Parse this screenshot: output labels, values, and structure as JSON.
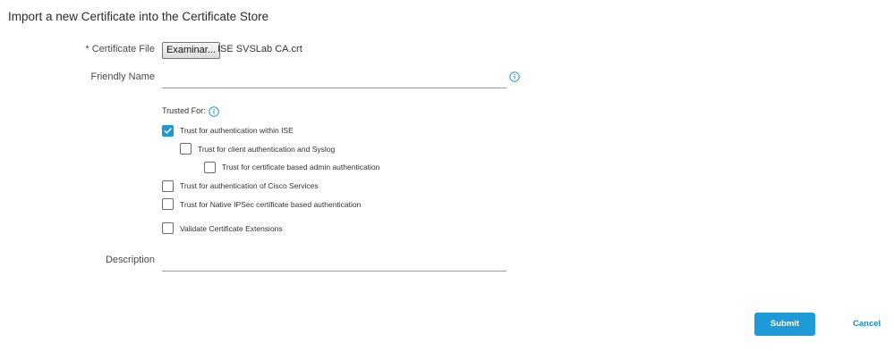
{
  "page": {
    "title": "Import a new Certificate into the Certificate Store"
  },
  "form": {
    "certificate_file": {
      "label": "* Certificate File",
      "button_label": "Examinar...",
      "file_name": "ISE SVSLab CA.crt"
    },
    "friendly_name": {
      "label": "Friendly Name",
      "value": ""
    },
    "trusted_for": {
      "label": "Trusted For:",
      "options": [
        {
          "label": "Trust for authentication within ISE",
          "checked": true
        },
        {
          "label": "Trust for client authentication and Syslog",
          "checked": false
        },
        {
          "label": "Trust for certificate based admin authentication",
          "checked": false
        },
        {
          "label": "Trust for authentication of Cisco Services",
          "checked": false
        },
        {
          "label": "Trust for Native IPSec certificate based authentication",
          "checked": false
        },
        {
          "label": "Validate Certificate Extensions",
          "checked": false
        }
      ]
    },
    "description": {
      "label": "Description",
      "value": ""
    }
  },
  "actions": {
    "submit_label": "Submit",
    "cancel_label": "Cancel"
  },
  "colors": {
    "accent": "#1f9ad8",
    "checkbox_checked": "#1e99d6",
    "link": "#1a8ccd"
  },
  "icons": {
    "info": "info-icon",
    "check": "checkmark-icon"
  }
}
